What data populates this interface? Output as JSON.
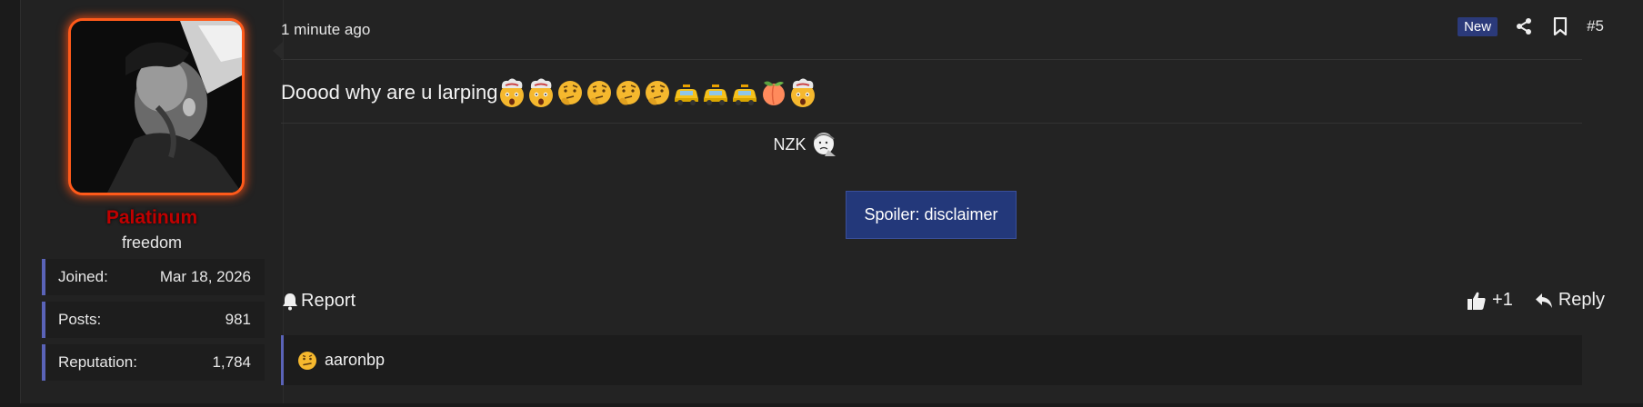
{
  "user": {
    "name": "Palatinum",
    "title": "freedom",
    "stats": [
      {
        "label": "Joined:",
        "value": "Mar 18, 2026"
      },
      {
        "label": "Posts:",
        "value": "981"
      },
      {
        "label": "Reputation:",
        "value": "1,784"
      }
    ]
  },
  "post": {
    "time": "1 minute ago",
    "badge": "New",
    "number": "#5",
    "message": "Doood why are u larping",
    "emojis": [
      "exploding-head",
      "exploding-head",
      "thinking-face",
      "thinking-face",
      "thinking-face",
      "thinking-face",
      "taxi",
      "taxi",
      "taxi",
      "peach",
      "exploding-head"
    ],
    "signature": "NZK",
    "spoiler_label": "Spoiler: disclaimer"
  },
  "actions": {
    "report": "Report",
    "like_count": "+1",
    "reply": "Reply"
  },
  "reactions": {
    "user": "aaronbp",
    "emoji": "confused-face"
  },
  "colors": {
    "accent": "#5a63b8",
    "username": "#c00000",
    "avatar_glow": "#ff5a1a",
    "spoiler_bg": "#23387a",
    "badge_bg": "#2b3a7a"
  }
}
